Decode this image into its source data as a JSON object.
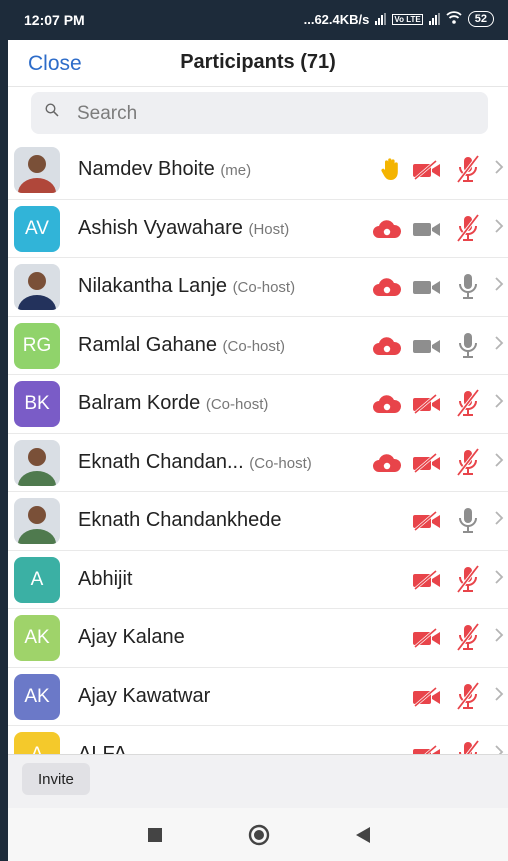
{
  "status_bar": {
    "time": "12:07 PM",
    "network": "...62.4KB/s",
    "volte": "Vo LTE",
    "battery": "52"
  },
  "header": {
    "close_label": "Close",
    "title": "Participants (71)"
  },
  "search": {
    "placeholder": "Search"
  },
  "participants": [
    {
      "name": "Namdev Bhoite",
      "role": "(me)",
      "avatar_type": "photo",
      "initials": "",
      "avatar_color": "#b0473a",
      "hand_raised": true,
      "recording": false,
      "video_on": false,
      "mic_on": false
    },
    {
      "name": "Ashish Vyawahare",
      "role": "(Host)",
      "avatar_type": "initials",
      "initials": "AV",
      "avatar_color": "#31b4d8",
      "hand_raised": false,
      "recording": true,
      "video_on": true,
      "mic_on": false
    },
    {
      "name": "Nilakantha Lanje",
      "role": "(Co-host)",
      "avatar_type": "photo",
      "initials": "",
      "avatar_color": "#23325c",
      "hand_raised": false,
      "recording": true,
      "video_on": true,
      "mic_on": true
    },
    {
      "name": "Ramlal Gahane",
      "role": "(Co-host)",
      "avatar_type": "initials",
      "initials": "RG",
      "avatar_color": "#90d36b",
      "hand_raised": false,
      "recording": true,
      "video_on": true,
      "mic_on": true
    },
    {
      "name": "Balram Korde",
      "role": "(Co-host)",
      "avatar_type": "initials",
      "initials": "BK",
      "avatar_color": "#7a5cc7",
      "hand_raised": false,
      "recording": true,
      "video_on": false,
      "mic_on": false
    },
    {
      "name": "Eknath Chandan...",
      "role": "(Co-host)",
      "avatar_type": "photo",
      "initials": "",
      "avatar_color": "#4f7a4e",
      "hand_raised": false,
      "recording": true,
      "video_on": false,
      "mic_on": false
    },
    {
      "name": "Eknath Chandankhede",
      "role": "",
      "avatar_type": "photo",
      "initials": "",
      "avatar_color": "#4f7a4e",
      "hand_raised": false,
      "recording": false,
      "video_on": false,
      "mic_on": true
    },
    {
      "name": "Abhijit",
      "role": "",
      "avatar_type": "initials",
      "initials": "A",
      "avatar_color": "#3bb0a4",
      "hand_raised": false,
      "recording": false,
      "video_on": false,
      "mic_on": false
    },
    {
      "name": "Ajay Kalane",
      "role": "",
      "avatar_type": "initials",
      "initials": "AK",
      "avatar_color": "#9fd36a",
      "hand_raised": false,
      "recording": false,
      "video_on": false,
      "mic_on": false
    },
    {
      "name": "Ajay Kawatwar",
      "role": "",
      "avatar_type": "initials",
      "initials": "AK",
      "avatar_color": "#6b79c8",
      "hand_raised": false,
      "recording": false,
      "video_on": false,
      "mic_on": false
    },
    {
      "name": "ALFA",
      "role": "",
      "avatar_type": "initials",
      "initials": "A",
      "avatar_color": "#f4c92b",
      "hand_raised": false,
      "recording": false,
      "video_on": false,
      "mic_on": false
    }
  ],
  "footer": {
    "invite_label": "Invite"
  },
  "colors": {
    "accent": "#2d6cc9",
    "muted_red": "#e8444a",
    "icon_gray": "#8e8e8e",
    "hand_yellow": "#f4b400"
  },
  "icons": {
    "hand": "raised-hand-icon",
    "recording": "cloud-recording-icon",
    "video": "video-camera-icon",
    "mic": "microphone-icon",
    "chevron": "chevron-right-icon",
    "nav_back": "back-triangle-icon",
    "nav_home": "home-circle-icon",
    "nav_recents": "recents-square-icon"
  }
}
